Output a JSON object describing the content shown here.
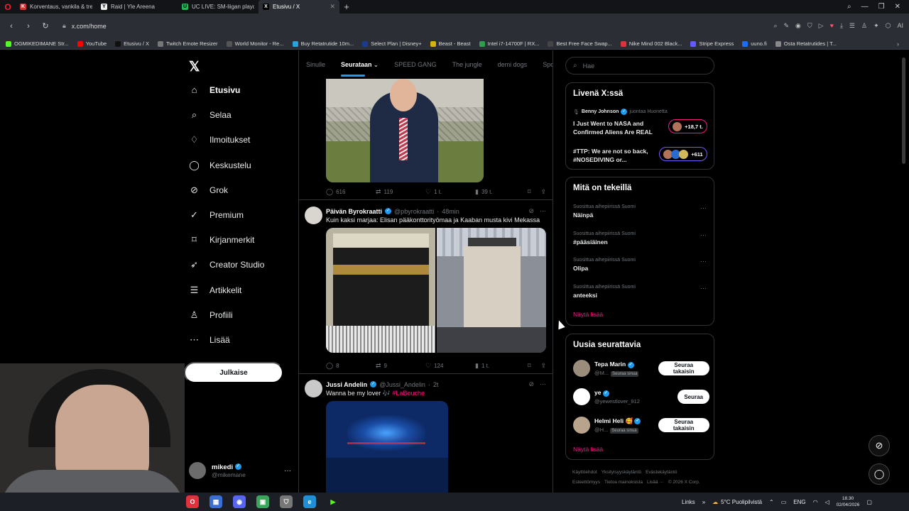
{
  "browser": {
    "tabs": [
      {
        "label": "Korventaus, vankila & tre",
        "fav": "K",
        "color": "#d53333",
        "active": false
      },
      {
        "label": "Raid | Yle Areena",
        "fav": "Y",
        "color": "#eeeeee",
        "active": false
      },
      {
        "label": "UC LIVE: SM-liigan playoff",
        "fav": "U",
        "color": "#1db954",
        "active": false
      },
      {
        "label": "Etusivu / X",
        "fav": "X",
        "color": "#000000",
        "active": true
      }
    ],
    "url": "x.com/home",
    "bookmarks": [
      {
        "label": "OGMIKEDIMANE Str...",
        "color": "#53fc18"
      },
      {
        "label": "YouTube",
        "color": "#ff0000"
      },
      {
        "label": "Etusivu / X",
        "color": "#111111"
      },
      {
        "label": "Twitch Emote Resizer",
        "color": "#777777"
      },
      {
        "label": "World Monitor - Re...",
        "color": "#555555"
      },
      {
        "label": "Buy Retatrutide 10m...",
        "color": "#2aa1d8"
      },
      {
        "label": "Select Plan | Disney+",
        "color": "#1a3c8f"
      },
      {
        "label": "Beast - Beast",
        "color": "#d4b400"
      },
      {
        "label": "Intel i7-14700F | RX...",
        "color": "#2e9e4f"
      },
      {
        "label": "Best Free Face Swap...",
        "color": "#444444"
      },
      {
        "label": "Nike Mind 002 Black...",
        "color": "#e0313d"
      },
      {
        "label": "Stripe Express",
        "color": "#635bff"
      },
      {
        "label": "uuno.fi",
        "color": "#1b6ef3"
      },
      {
        "label": "Osta Retatrutides | T...",
        "color": "#888888"
      }
    ]
  },
  "nav": {
    "items": [
      {
        "label": "Etusivu",
        "icon": "⌂",
        "active": true
      },
      {
        "label": "Selaa",
        "icon": "⌕",
        "active": false
      },
      {
        "label": "Ilmoitukset",
        "icon": "♢",
        "active": false
      },
      {
        "label": "Keskustelu",
        "icon": "◯",
        "active": false
      },
      {
        "label": "Grok",
        "icon": "⊘",
        "active": false
      },
      {
        "label": "Premium",
        "icon": "✓",
        "active": false
      },
      {
        "label": "Kirjanmerkit",
        "icon": "⌑",
        "active": false
      },
      {
        "label": "Creator Studio",
        "icon": "➶",
        "active": false
      },
      {
        "label": "Artikkelit",
        "icon": "☰",
        "active": false
      },
      {
        "label": "Profiili",
        "icon": "♙",
        "active": false
      },
      {
        "label": "Lisää",
        "icon": "⋯",
        "active": false
      }
    ],
    "post_label": "Julkaise",
    "account": {
      "name": "mikedi",
      "handle": "@mikemane"
    }
  },
  "timeline": {
    "tabs": [
      "Sinulle",
      "Seurataan",
      "SPEED GANG",
      "The jungle",
      "demi dogs",
      "Sport"
    ],
    "active_tab": "Seurataan",
    "first_stats": {
      "replies": "616",
      "reposts": "119",
      "likes": "1 t.",
      "views": "39 t."
    },
    "tweets": [
      {
        "name": "Päivän Byrokraatti",
        "handle": "@pbyrokraatti",
        "time": "48min",
        "text": "Kuin kaksi marjaa: Elisan pääkonttorityömaa ja Kaaban musta kivi Mekassa",
        "stats": {
          "replies": "8",
          "reposts": "9",
          "likes": "124",
          "views": "1 t."
        }
      },
      {
        "name": "Jussi Andelin",
        "handle": "@Jussi_Andelin",
        "time": "2t",
        "text": "Wanna be my lover 🎶",
        "tag": "#LaBouche"
      }
    ]
  },
  "right": {
    "search_placeholder": "Hae",
    "live": {
      "title": "Livenä X:ssä",
      "host": "Benny Johnson",
      "host_suffix": "juontaa Huonetta",
      "spaces": [
        {
          "title": "I Just Went to NASA and Confirmed Aliens Are REAL",
          "count": "+18,7 t."
        },
        {
          "title": "#TTP: We are not so back, #NOSEDIVING or...",
          "count": "+611"
        }
      ]
    },
    "trends": {
      "title": "Mitä on tekeillä",
      "items": [
        {
          "context": "Suosittua aihepiirissä Suomi",
          "name": "Näinpä"
        },
        {
          "context": "Suosittua aihepiirissä Suomi",
          "name": "#pääsiäinen"
        },
        {
          "context": "Suosittua aihepiirissä Suomi",
          "name": "Olipa"
        },
        {
          "context": "Suosittua aihepiirissä Suomi",
          "name": "anteeksi"
        }
      ],
      "show_more": "Näytä lisää"
    },
    "follow": {
      "title": "Uusia seurattavia",
      "items": [
        {
          "name": "Tepa Marin",
          "handle": "@M...",
          "badge": "Seuraa sinua",
          "button": "Seuraa takaisin"
        },
        {
          "name": "ye",
          "handle": "@yewestlover_912",
          "badge": "",
          "button": "Seuraa"
        },
        {
          "name": "Helmi Heli 🥰",
          "handle": "@H...",
          "badge": "Seuraa sinua",
          "button": "Seuraa takaisin"
        }
      ],
      "show_more": "Näytä lisää"
    },
    "footer": {
      "line1": [
        "Käyttöehdot",
        "Yksityisyyskäytäntö",
        "Evästekäytäntö"
      ],
      "line2": [
        "Esteettömyys",
        "Tietoa mainoksista",
        "Lisää ···"
      ],
      "copyright": "© 2026 X Corp."
    }
  },
  "taskbar": {
    "links": "Links",
    "weather": "5°C  Puolipilvistä",
    "lang": "ENG",
    "time": "18.30",
    "date": "02/04/2026"
  }
}
